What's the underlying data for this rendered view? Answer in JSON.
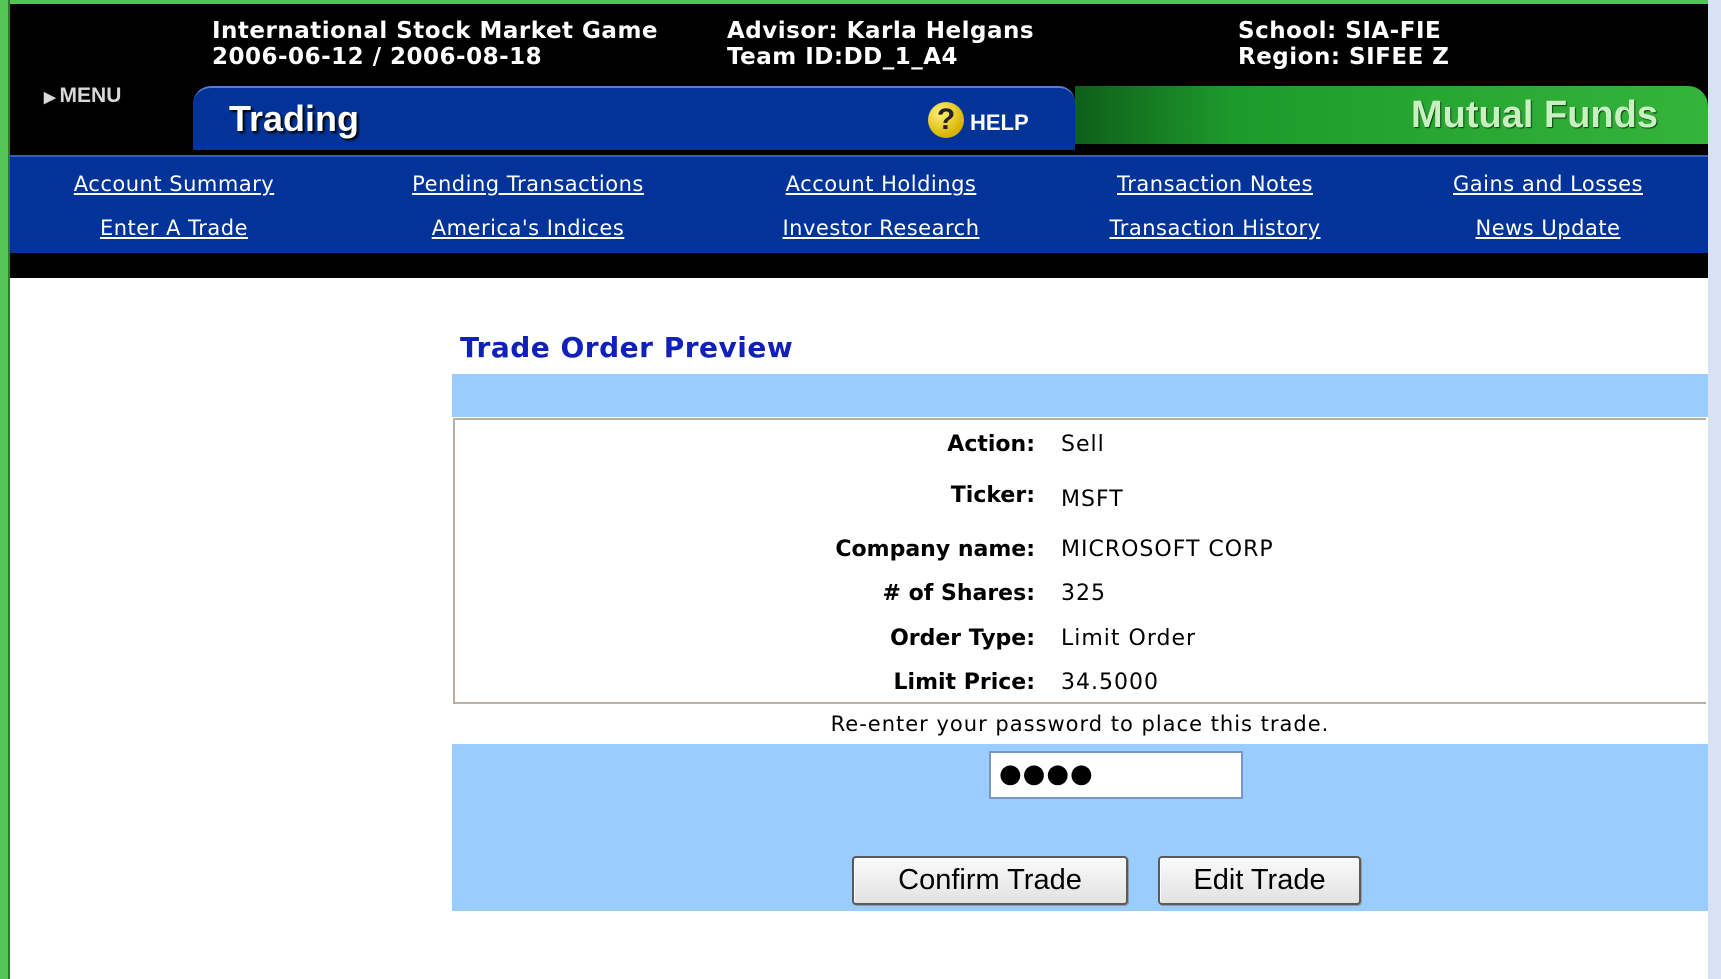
{
  "header": {
    "game_title": "International Stock Market Game",
    "game_dates": "2006-06-12 / 2006-08-18",
    "advisor": "Advisor: Karla Helgans",
    "team_id": "Team ID:DD_1_A4",
    "school": "School: SIA-FIE",
    "region": "Region: SIFEE Z",
    "menu_label": "MENU"
  },
  "tabs": {
    "active": "Trading",
    "help_label": "HELP",
    "inactive": "Mutual Funds"
  },
  "nav": {
    "row1": [
      "Account Summary",
      "Pending Transactions",
      "Account Holdings",
      "Transaction Notes",
      "Gains and Losses"
    ],
    "row2": [
      "Enter A Trade",
      "America's Indices",
      "Investor Research",
      "Transaction History",
      "News Update"
    ]
  },
  "preview": {
    "title": "Trade Order Preview",
    "rows": [
      {
        "label": "Action:",
        "value": "Sell"
      },
      {
        "label": "Ticker:",
        "value": "MSFT"
      },
      {
        "label": "Company name:",
        "value": "MICROSOFT CORP"
      },
      {
        "label": "# of Shares:",
        "value": "325"
      },
      {
        "label": "Order Type:",
        "value": "Limit Order"
      },
      {
        "label": "Limit Price:",
        "value": "34.5000"
      }
    ],
    "password_prompt": "Re-enter your password to place this trade.",
    "password_value": "●●●●",
    "confirm_label": "Confirm Trade",
    "edit_label": "Edit Trade"
  },
  "colors": {
    "frame_green": "#54c454",
    "nav_blue": "#013399",
    "band_blue": "#99ccff",
    "title_blue": "#1020b8"
  },
  "icons": {
    "menu": "triangle-right-icon",
    "help": "question-mark-icon"
  }
}
